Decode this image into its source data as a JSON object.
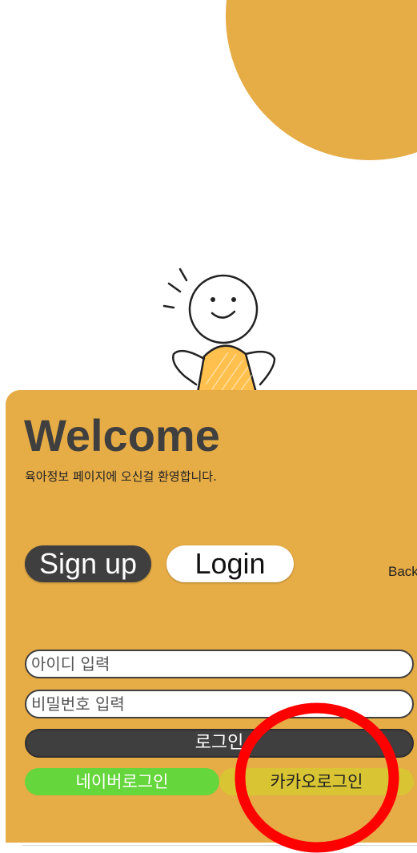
{
  "colors": {
    "accent": "#e6ac46",
    "dark": "#3f3f3f",
    "naver": "#66d63d",
    "kakao": "#d9c533",
    "annotation": "#ff0000"
  },
  "welcome": {
    "title": "Welcome",
    "subtitle": "육아정보 페이지에 오신걸 환영합니다."
  },
  "tabs": {
    "signup_label": "Sign up",
    "login_label": "Login",
    "back_label": "Back"
  },
  "form": {
    "id_placeholder": "아이디 입력",
    "password_placeholder": "비밀번호 입력",
    "submit_label": "로그인"
  },
  "social": {
    "naver_label": "네이버로그인",
    "kakao_label": "카카오로그인"
  },
  "icons": {
    "mascot": "waving-person-illustration",
    "annotation": "red-circle-annotation"
  }
}
